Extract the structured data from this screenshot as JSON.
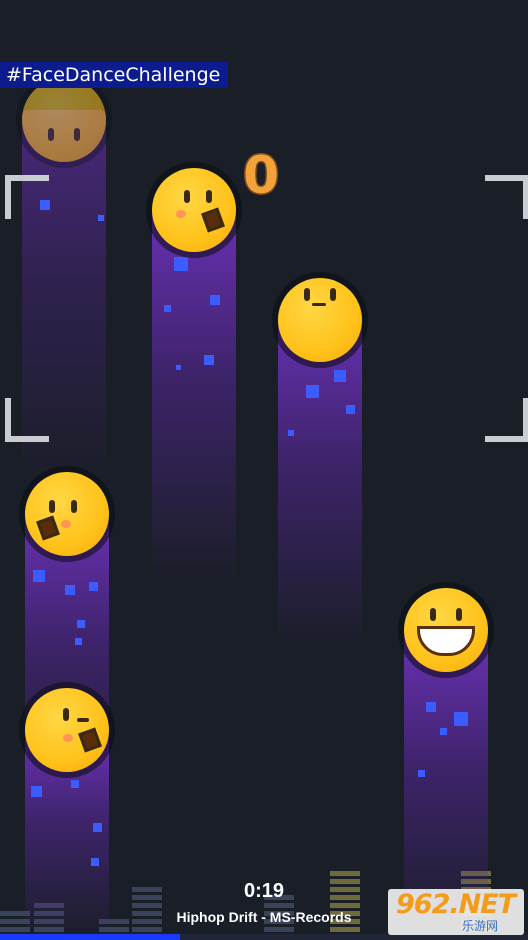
{
  "hashtag": "#FaceDanceChallenge",
  "score": "0",
  "timer": "0:19",
  "song": "Hiphop Drift - MS-Records",
  "progress_fraction": 0.34,
  "watermark": {
    "main": "962.NET",
    "sub": "乐游网"
  },
  "faces": [
    {
      "expression": "neutral-faded"
    },
    {
      "expression": "open-mouth-blush"
    },
    {
      "expression": "neutral-smile"
    },
    {
      "expression": "open-mouth-blush-left"
    },
    {
      "expression": "wink-open-mouth"
    },
    {
      "expression": "big-grin"
    }
  ],
  "colors": {
    "background": "#1a1e27",
    "face": "#ffc21a",
    "trail": "#6e32be",
    "progress": "#1a3bff",
    "score": "#f2a23a"
  }
}
